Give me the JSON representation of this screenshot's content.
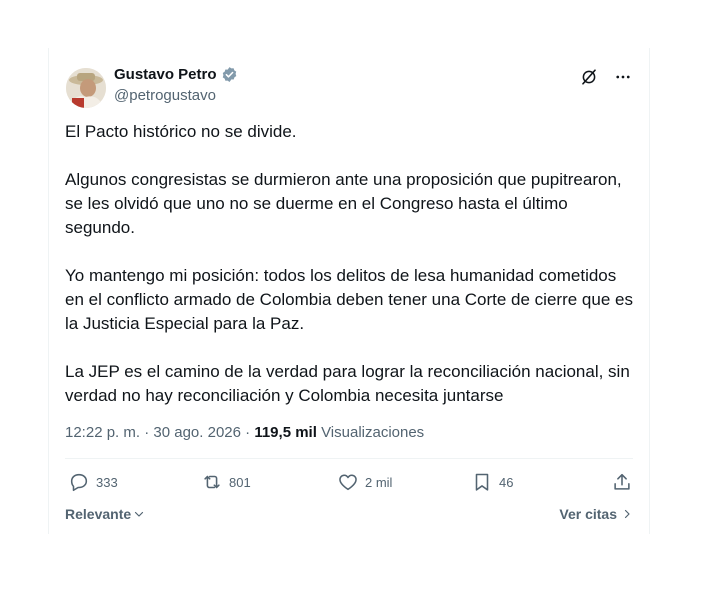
{
  "author": {
    "name": "Gustavo Petro",
    "handle": "@petrogustavo"
  },
  "tweet": {
    "paragraphs": [
      "El Pacto histórico no se divide.",
      "Algunos congresistas se durmieron ante una proposición que pupitrearon, se les olvidó que uno no se duerme en el Congreso hasta el último segundo.",
      "Yo mantengo mi posición: todos los delitos de lesa humanidad cometidos en el conflicto armado de Colombia deben tener una Corte de cierre que es la Justicia Especial para la Paz.",
      "La JEP es el camino de la verdad para lograr la reconciliación nacional, sin verdad no hay reconciliación y Colombia necesita juntarse"
    ],
    "time": "12:22 p. m.",
    "separator": "·",
    "date": "30 ago. 2026",
    "views_count": "119,5 mil",
    "views_label": "Visualizaciones"
  },
  "actions": {
    "replies": "333",
    "reposts": "801",
    "likes": "2 mil",
    "bookmarks": "46"
  },
  "footer": {
    "sort_label": "Relevante",
    "quotes_label": "Ver citas"
  },
  "colors": {
    "verified": "#829aab",
    "secondary_text": "#536471",
    "primary_text": "#0f1419"
  }
}
